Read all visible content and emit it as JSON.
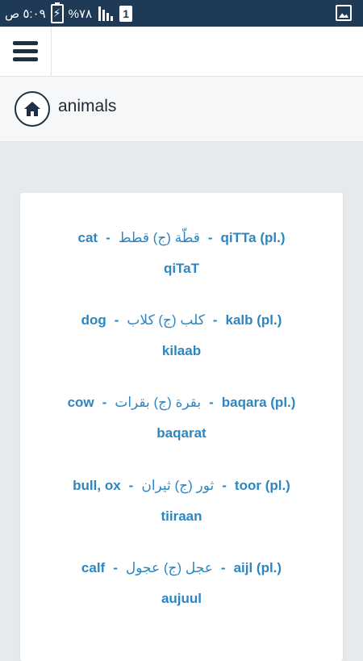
{
  "status_bar": {
    "time": "٥:٠٩ ص",
    "battery_percent": "%٧٨",
    "sim_slot": "1"
  },
  "breadcrumb": {
    "title": "animals"
  },
  "entries": [
    {
      "english": "cat",
      "arabic": "قطّة (ج) قطط",
      "translit": "qiTTa (pl.)",
      "plural": "qiTaT"
    },
    {
      "english": "dog",
      "arabic": "كلب (ج) كلاب",
      "translit": "kalb (pl.)",
      "plural": "kilaab"
    },
    {
      "english": "cow",
      "arabic": "بقرة (ج) بقرات",
      "translit": "baqara (pl.)",
      "plural": "baqarat"
    },
    {
      "english": "bull, ox",
      "arabic": "ثور (ج) ثيران",
      "translit": "toor (pl.)",
      "plural": "tiiraan"
    },
    {
      "english": "calf",
      "arabic": "عجل (ج) عجول",
      "translit": "aijl (pl.)",
      "plural": "aujuul"
    }
  ],
  "separator": "-",
  "colors": {
    "status_bar": "#1f3a57",
    "link_text": "#2e86c1",
    "page_background": "#e7eaed"
  }
}
